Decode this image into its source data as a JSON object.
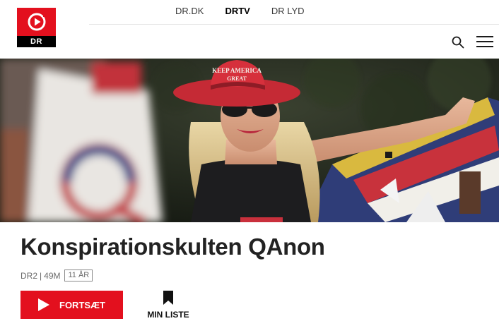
{
  "brand": {
    "logo_text": "DR",
    "accent": "#e3101e"
  },
  "nav": {
    "items": [
      {
        "label": "DR.DK",
        "active": false
      },
      {
        "label": "DRTV",
        "active": true
      },
      {
        "label": "DR LYD",
        "active": false
      }
    ]
  },
  "header_icons": {
    "search": "search-icon",
    "menu": "hamburger-menu-icon"
  },
  "hero": {
    "image": "woman-in-red-cowboy-hat-with-flag",
    "hat_text_1": "KEEP AMERICA",
    "hat_text_2": "GREAT"
  },
  "program": {
    "title": "Konspirationskulten QAnon",
    "channel": "DR2",
    "separator": "|",
    "duration": "49M",
    "age_rating": "11 ÅR"
  },
  "actions": {
    "play_label": "FORTSÆT",
    "mylist_label": "MIN LISTE"
  }
}
